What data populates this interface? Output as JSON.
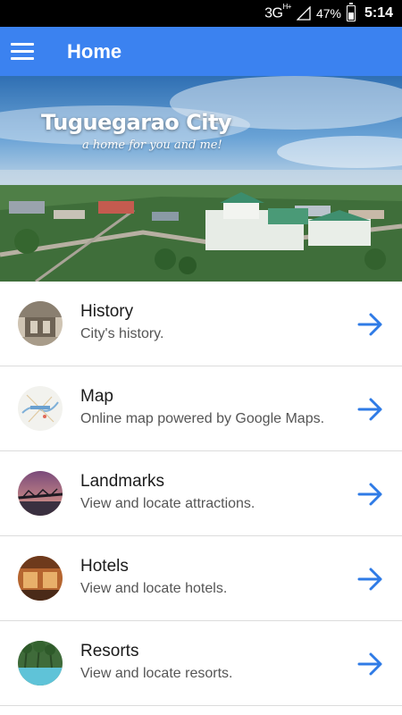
{
  "status_bar": {
    "network": "3G",
    "network_sup": "H+",
    "battery": "47%",
    "battery_level": 0.47,
    "time": "5:14"
  },
  "app_bar": {
    "title": "Home",
    "menu_icon": "hamburger-menu-icon"
  },
  "hero": {
    "title": "Tuguegarao City",
    "tagline": "a home for you and me!"
  },
  "list": [
    {
      "title": "History",
      "subtitle": "City's history.",
      "icon": "arrow-right-icon"
    },
    {
      "title": "Map",
      "subtitle": "Online map powered by Google Maps.",
      "icon": "arrow-right-icon"
    },
    {
      "title": "Landmarks",
      "subtitle": "View and locate attractions.",
      "icon": "arrow-right-icon"
    },
    {
      "title": "Hotels",
      "subtitle": "View and locate hotels.",
      "icon": "arrow-right-icon"
    },
    {
      "title": "Resorts",
      "subtitle": "View and locate resorts.",
      "icon": "arrow-right-icon"
    }
  ],
  "colors": {
    "primary": "#3b82f0",
    "arrow": "#2f7be6",
    "divider": "#dcdcdc"
  }
}
